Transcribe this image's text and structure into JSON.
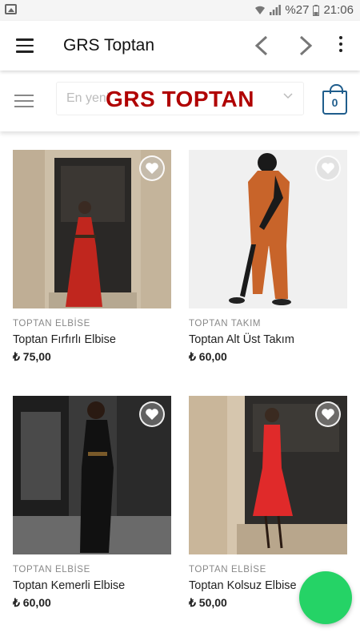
{
  "status_bar": {
    "battery": "%27",
    "time": "21:06"
  },
  "appbar": {
    "title": "GRS Toptan"
  },
  "site_header": {
    "search_placeholder": "En yeni",
    "logo_text": "GRS TOPTAN",
    "cart_count": "0"
  },
  "products": [
    {
      "category": "TOPTAN ELBİSE",
      "name": "Toptan Fırfırlı Elbise",
      "price": "₺ 75,00"
    },
    {
      "category": "TOPTAN TAKIM",
      "name": "Toptan Alt Üst Takım",
      "price": "₺ 60,00"
    },
    {
      "category": "TOPTAN ELBİSE",
      "name": "Toptan Kemerli Elbise",
      "price": "₺ 60,00"
    },
    {
      "category": "TOPTAN ELBİSE",
      "name": "Toptan Kolsuz Elbise",
      "price": "₺ 50,00"
    }
  ],
  "colors": {
    "logo": "#b00000",
    "cart": "#1f5d8c",
    "whatsapp": "#25d366"
  }
}
